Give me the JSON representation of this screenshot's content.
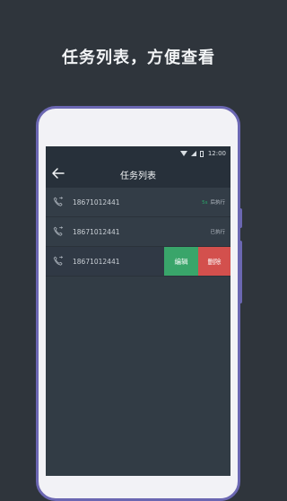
{
  "headline": "任务列表，方便查看",
  "statusbar": {
    "time": "12:00"
  },
  "appbar": {
    "title": "任务列表"
  },
  "tasks": [
    {
      "number": "18671012441",
      "count": "5s",
      "status": "后执行"
    },
    {
      "number": "18671012441",
      "status": "已执行"
    },
    {
      "number": "18671012441",
      "actions": {
        "edit": "编辑",
        "delete": "删除"
      }
    }
  ],
  "colors": {
    "background": "#2f353c",
    "frame": "#6b67b2",
    "edit": "#39a56a",
    "delete": "#d3504d",
    "accent": "#2aa86a"
  },
  "icons": {
    "back": "arrow-left-icon",
    "call": "phone-icon"
  }
}
